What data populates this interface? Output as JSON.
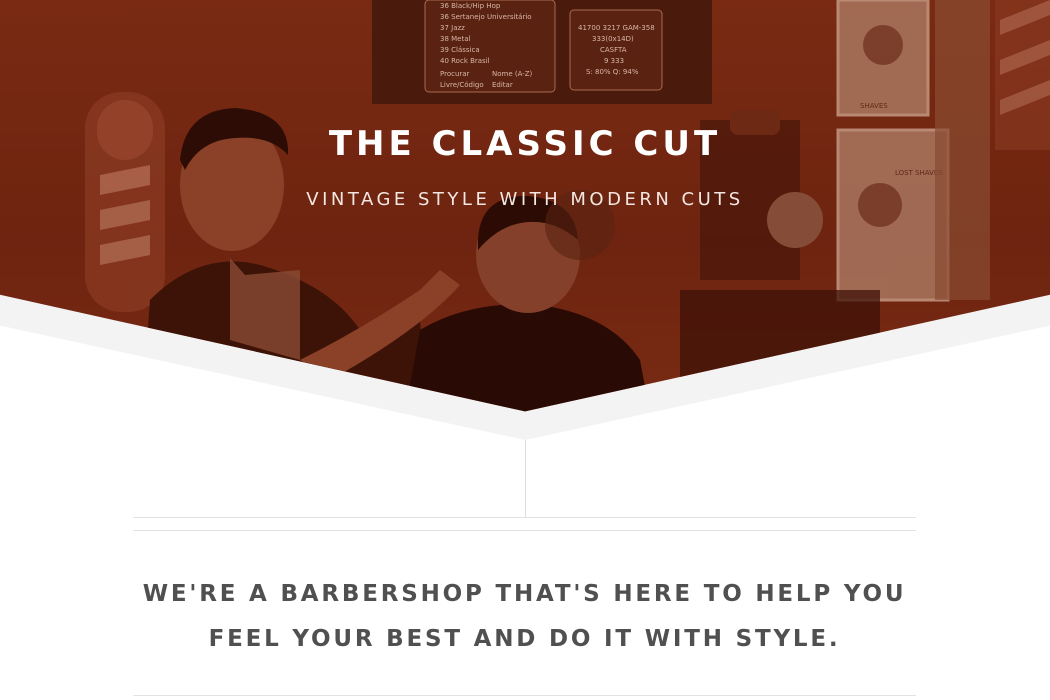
{
  "hero": {
    "title": "THE CLASSIC CUT",
    "subtitle": "VINTAGE STYLE WITH MODERN CUTS",
    "overlay_color": "#7a2a12",
    "photo_screen": {
      "menu_lines": [
        "36 Black/Hip Hop",
        "36 Sertanejo Universitário",
        "37 Jazz",
        "38 Metal",
        "39 Clássica",
        "40 Rock Brasil"
      ],
      "legend": [
        "Procurar",
        "Nome (A-Z)",
        "Livre/Código",
        "Editar"
      ],
      "stats": [
        "41700  3217  GAM-358",
        "333(0x14D)",
        "CASFTA",
        "9 333",
        "S: 80%   Q: 94%"
      ]
    },
    "poster_text": [
      "SHAVES",
      "LOST SHAVES"
    ]
  },
  "intro": {
    "text": "WE'RE A BARBERSHOP THAT'S HERE TO HELP YOU FEEL YOUR BEST AND DO IT WITH STYLE."
  },
  "colors": {
    "heading_text": "#505050",
    "divider": "#e2e2e2",
    "background": "#ffffff"
  }
}
